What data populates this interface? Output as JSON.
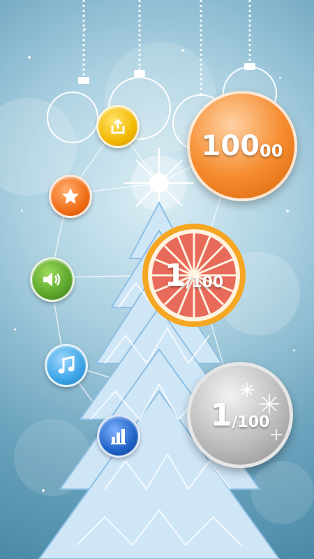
{
  "scores": {
    "orange_score_main": "100",
    "orange_score_suffix": "00",
    "grapefruit_level_main": "1",
    "grapefruit_level_suffix": "/100",
    "silver_level_main": "1",
    "silver_level_suffix": "/100"
  },
  "menu": {
    "share_icon": "share-icon",
    "rate_icon": "star-icon",
    "sound_icon": "speaker-icon",
    "music_icon": "music-note-icon",
    "leaderboard_icon": "bar-chart-icon"
  },
  "colors": {
    "share": "#f2b800",
    "rate": "#f06d16",
    "sound": "#5aa52a",
    "music": "#3aa3e6",
    "leaderboard": "#1e62c6",
    "orange_ball": "#f58a2c",
    "silver_ball": "#bdbdbd"
  }
}
